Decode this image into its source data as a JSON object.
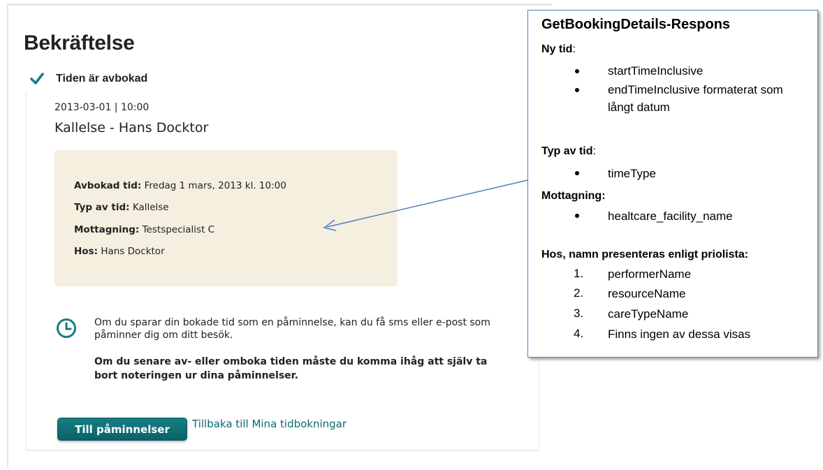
{
  "page": {
    "title": "Bekräftelse",
    "status": "Tiden är avbokad"
  },
  "booking": {
    "datetime": "2013-03-01 | 10:00",
    "title": "Kallelse - Hans Docktor",
    "details": [
      {
        "label": "Avbokad tid:",
        "value": "Fredag 1 mars, 2013 kl. 10:00"
      },
      {
        "label": "Typ av tid:",
        "value": "Kallelse"
      },
      {
        "label": "Mottagning:",
        "value": "Testspecialist C"
      },
      {
        "label": "Hos:",
        "value": "Hans Docktor"
      }
    ]
  },
  "reminder": {
    "text": "Om du sparar din bokade tid som en påminnelse, kan du få sms eller e-post som påminner dig om ditt besök.",
    "warning": "Om du senare av- eller omboka tiden måste du komma ihåg att själv ta bort noteringen ur dina påminnelser."
  },
  "actions": {
    "reminders_button": "Till påminnelser",
    "back_link": "Tillbaka till Mina tidbokningar"
  },
  "callout": {
    "title": "GetBookingDetails-Respons",
    "sections": [
      {
        "heading": "Ny tid",
        "suffix": ":",
        "items": [
          "startTimeInclusive",
          "endTimeInclusive formaterat som långt datum"
        ]
      },
      {
        "heading": "Typ av tid",
        "suffix": ":",
        "items": [
          "timeType"
        ]
      },
      {
        "heading": "Mottagning:",
        "suffix": "",
        "items": [
          "healtcare_facility_name"
        ]
      },
      {
        "heading": "Hos, namn presenteras enligt priolista:",
        "suffix": "",
        "items": [
          "performerName",
          "resourceName",
          "careTypeName",
          "Finns ingen av dessa visas"
        ]
      }
    ],
    "numbers": [
      "1.",
      "2.",
      "3.",
      "4."
    ]
  },
  "colors": {
    "accent": "#0d6f75",
    "details_bg": "#f5efe0",
    "callout_border": "#4f81bd"
  },
  "icons": [
    "check-icon",
    "clock-icon",
    "arrow-pointer"
  ]
}
